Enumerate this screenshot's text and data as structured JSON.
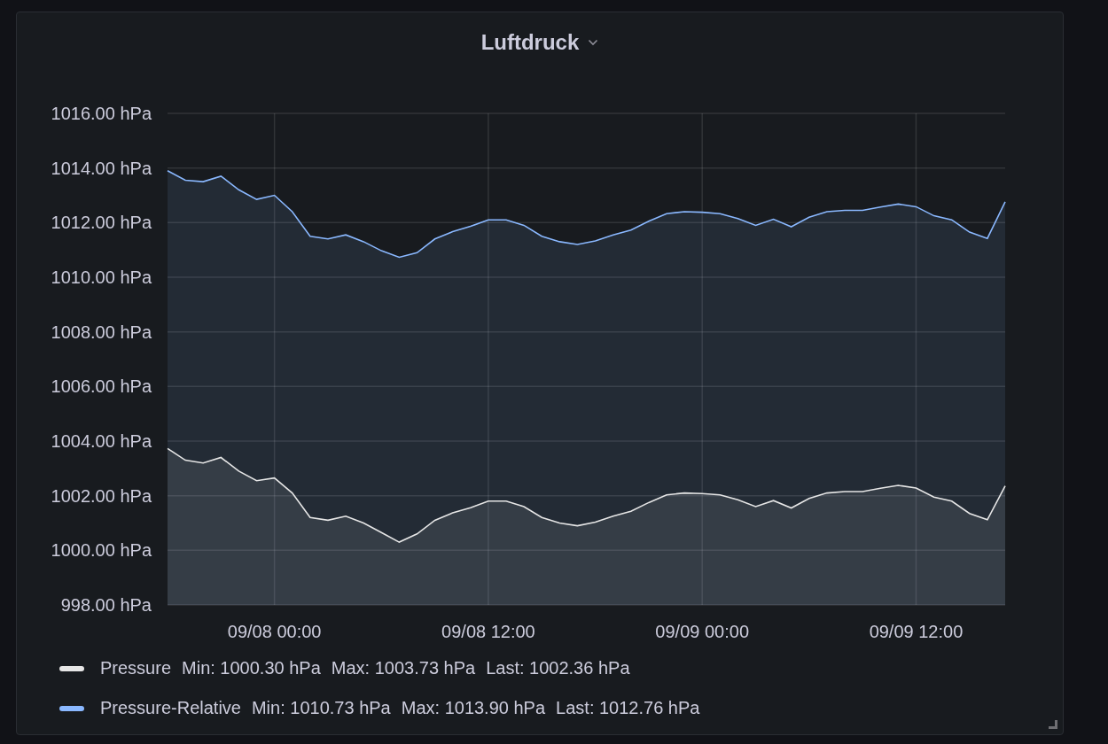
{
  "panel": {
    "title": "Luftdruck",
    "chart_data": {
      "type": "area",
      "grid": true,
      "ylim": [
        998,
        1016
      ],
      "yticks": [
        {
          "value": 998,
          "label": "998.00 hPa"
        },
        {
          "value": 1000,
          "label": "1000.00 hPa"
        },
        {
          "value": 1002,
          "label": "1002.00 hPa"
        },
        {
          "value": 1004,
          "label": "1004.00 hPa"
        },
        {
          "value": 1006,
          "label": "1006.00 hPa"
        },
        {
          "value": 1008,
          "label": "1008.00 hPa"
        },
        {
          "value": 1010,
          "label": "1010.00 hPa"
        },
        {
          "value": 1012,
          "label": "1012.00 hPa"
        },
        {
          "value": 1014,
          "label": "1014.00 hPa"
        },
        {
          "value": 1016,
          "label": "1016.00 hPa"
        }
      ],
      "categories": [
        null,
        null,
        null,
        null,
        null,
        null,
        "09/08 00:00",
        null,
        null,
        null,
        null,
        null,
        null,
        null,
        null,
        null,
        null,
        null,
        "09/08 12:00",
        null,
        null,
        null,
        null,
        null,
        null,
        null,
        null,
        null,
        null,
        null,
        "09/09 00:00",
        null,
        null,
        null,
        null,
        null,
        null,
        null,
        null,
        null,
        null,
        null,
        "09/09 12:00",
        null,
        null,
        null,
        null,
        null
      ],
      "series": [
        {
          "name": "Pressure",
          "color": "#e6e6e6",
          "values": [
            1003.73,
            1003.3,
            1003.2,
            1003.4,
            1002.9,
            1002.55,
            1002.65,
            1002.1,
            1001.2,
            1001.1,
            1001.25,
            1001.0,
            1000.65,
            1000.3,
            1000.6,
            1001.1,
            1001.37,
            1001.56,
            1001.8,
            1001.8,
            1001.6,
            1001.2,
            1001.0,
            1000.9,
            1001.03,
            1001.25,
            1001.43,
            1001.75,
            1002.03,
            1002.1,
            1002.08,
            1002.03,
            1001.85,
            1001.6,
            1001.82,
            1001.55,
            1001.9,
            1002.1,
            1002.15,
            1002.15,
            1002.27,
            1002.38,
            1002.28,
            1001.95,
            1001.8,
            1001.35,
            1001.12,
            1002.36
          ]
        },
        {
          "name": "Pressure-Relative",
          "color": "#8ab8ff",
          "values": [
            1013.9,
            1013.55,
            1013.5,
            1013.7,
            1013.2,
            1012.85,
            1013.0,
            1012.4,
            1011.5,
            1011.4,
            1011.55,
            1011.3,
            1010.97,
            1010.73,
            1010.9,
            1011.4,
            1011.67,
            1011.86,
            1012.1,
            1012.1,
            1011.9,
            1011.5,
            1011.3,
            1011.2,
            1011.33,
            1011.55,
            1011.73,
            1012.05,
            1012.33,
            1012.4,
            1012.38,
            1012.33,
            1012.15,
            1011.9,
            1012.12,
            1011.85,
            1012.2,
            1012.4,
            1012.45,
            1012.45,
            1012.57,
            1012.68,
            1012.58,
            1012.25,
            1012.1,
            1011.65,
            1011.42,
            1012.76
          ]
        }
      ]
    },
    "legend": [
      {
        "stats": [
          "Min: 1000.30 hPa",
          "Max: 1003.73 hPa",
          "Last: 1002.36 hPa"
        ]
      },
      {
        "stats": [
          "Min: 1010.73 hPa",
          "Max: 1013.90 hPa",
          "Last: 1012.76 hPa"
        ]
      }
    ]
  }
}
